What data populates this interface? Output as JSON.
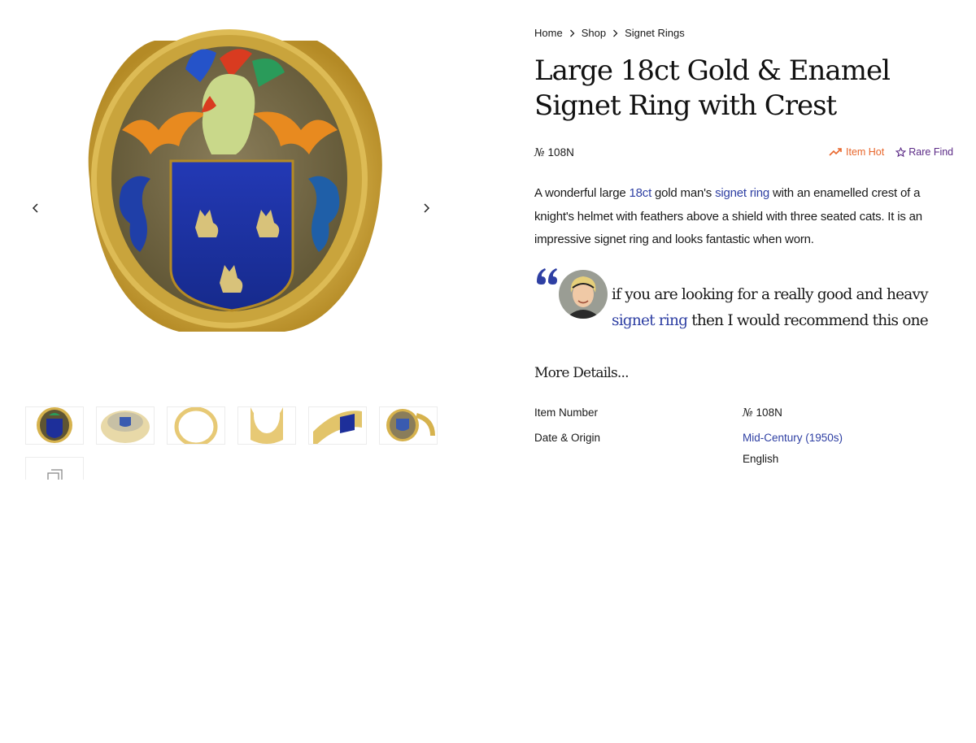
{
  "breadcrumb": {
    "home": "Home",
    "shop": "Shop",
    "category": "Signet Rings"
  },
  "product": {
    "title": "Large 18ct Gold & Enamel Signet Ring with Crest",
    "number_symbol": "№",
    "number": "108N",
    "badges": {
      "hot": "Item Hot",
      "rare": "Rare Find"
    },
    "description": {
      "part1": "A wonderful large ",
      "link1": "18ct",
      "part2": " gold man's ",
      "link2": "signet ring",
      "part3": " with an enamelled crest of a knight's helmet with feathers above a shield with three seated cats. It is an impressive signet ring and looks fantastic when worn."
    }
  },
  "quote": {
    "text1": "if you are looking for a really good and heavy ",
    "link": "signet ring",
    "text2": " then I would recommend this one"
  },
  "more_details_label": "More Details...",
  "details": [
    {
      "key": "Item Number",
      "value_prefix": "№",
      "value": "108N"
    },
    {
      "key": "Date & Origin",
      "value_link": "Mid-Century (1950s)",
      "value2": "English"
    }
  ],
  "gallery": {
    "thumbnail_count": 7,
    "icons": {
      "prev": "chevron-left-icon",
      "next": "chevron-right-icon",
      "more": "gallery-stack-icon"
    }
  },
  "colors": {
    "link": "#2e3fa3",
    "hot": "#e8662b",
    "rare": "#5b2a86",
    "quote_mark": "#2e3fa3",
    "gold": "#c9a43c",
    "enamel_blue": "#1d2f9a"
  }
}
